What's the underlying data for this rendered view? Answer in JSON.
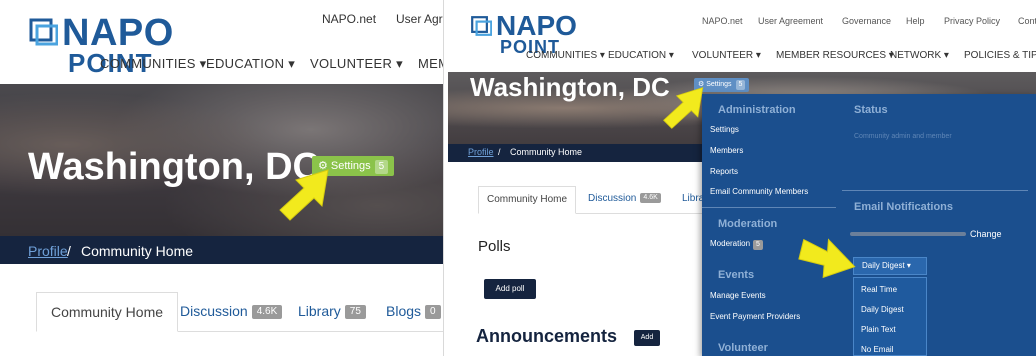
{
  "left": {
    "logo_word": "NAPO",
    "logo_sub": "POINT",
    "util_links": [
      "NAPO.net",
      "User Agre"
    ],
    "nav": [
      "COMMUNITIES ▾",
      "EDUCATION ▾",
      "VOLUNTEER ▾",
      "MEM"
    ],
    "title": "Washington, DC",
    "settings_label": "⚙ Settings",
    "settings_count": "5",
    "breadcrumb": {
      "profile": "Profile",
      "sep": "/",
      "current": "Community Home"
    },
    "tabs": [
      {
        "label": "Community Home",
        "badge": ""
      },
      {
        "label": "Discussion",
        "badge": "4.6K"
      },
      {
        "label": "Library",
        "badge": "75"
      },
      {
        "label": "Blogs",
        "badge": "0"
      }
    ]
  },
  "right": {
    "logo_word": "NAPO",
    "logo_sub": "POINT",
    "util_links": [
      "NAPO.net",
      "User Agreement",
      "Governance",
      "Help",
      "Privacy Policy",
      "Cont"
    ],
    "nav": [
      "COMMUNITIES ▾",
      "EDUCATION ▾",
      "VOLUNTEER ▾",
      "MEMBER RESOURCES ▾",
      "NETWORK ▾",
      "POLICIES & TIP"
    ],
    "title": "Washington, DC",
    "settings_label": "⚙ Settings",
    "settings_count": "5",
    "breadcrumb": {
      "profile": "Profile",
      "sep": "/",
      "current": "Community Home"
    },
    "tabs": [
      {
        "label": "Community Home",
        "badge": ""
      },
      {
        "label": "Discussion",
        "badge": "4.6K"
      },
      {
        "label": "Libra",
        "badge": ""
      }
    ],
    "polls_heading": "Polls",
    "add_poll": "Add poll",
    "announcements_heading": "Announcements",
    "add_label": "Add",
    "dropdown": {
      "administration_heading": "Administration",
      "admin_items": [
        "Settings",
        "Members",
        "Reports",
        "Email Community Members"
      ],
      "moderation_heading": "Moderation",
      "moderation_item": "Moderation",
      "moderation_count": "5",
      "events_heading": "Events",
      "events_items": [
        "Manage Events",
        "Event Payment Providers"
      ],
      "volunteer_heading": "Volunteer",
      "status_heading": "Status",
      "status_text": "Community admin and member",
      "email_notifications_heading": "Email Notifications",
      "change_label": "Change",
      "digest_selected": "Daily Digest ▾",
      "digest_options": [
        "Real Time",
        "Daily Digest",
        "Plain Text",
        "No Email"
      ]
    }
  },
  "colors": {
    "brand_blue": "#1f5a99",
    "navy": "#15243f",
    "settings_green": "#8bc34a",
    "dropdown_blue": "#1b4f8e",
    "arrow_yellow": "#f2ea1d"
  }
}
